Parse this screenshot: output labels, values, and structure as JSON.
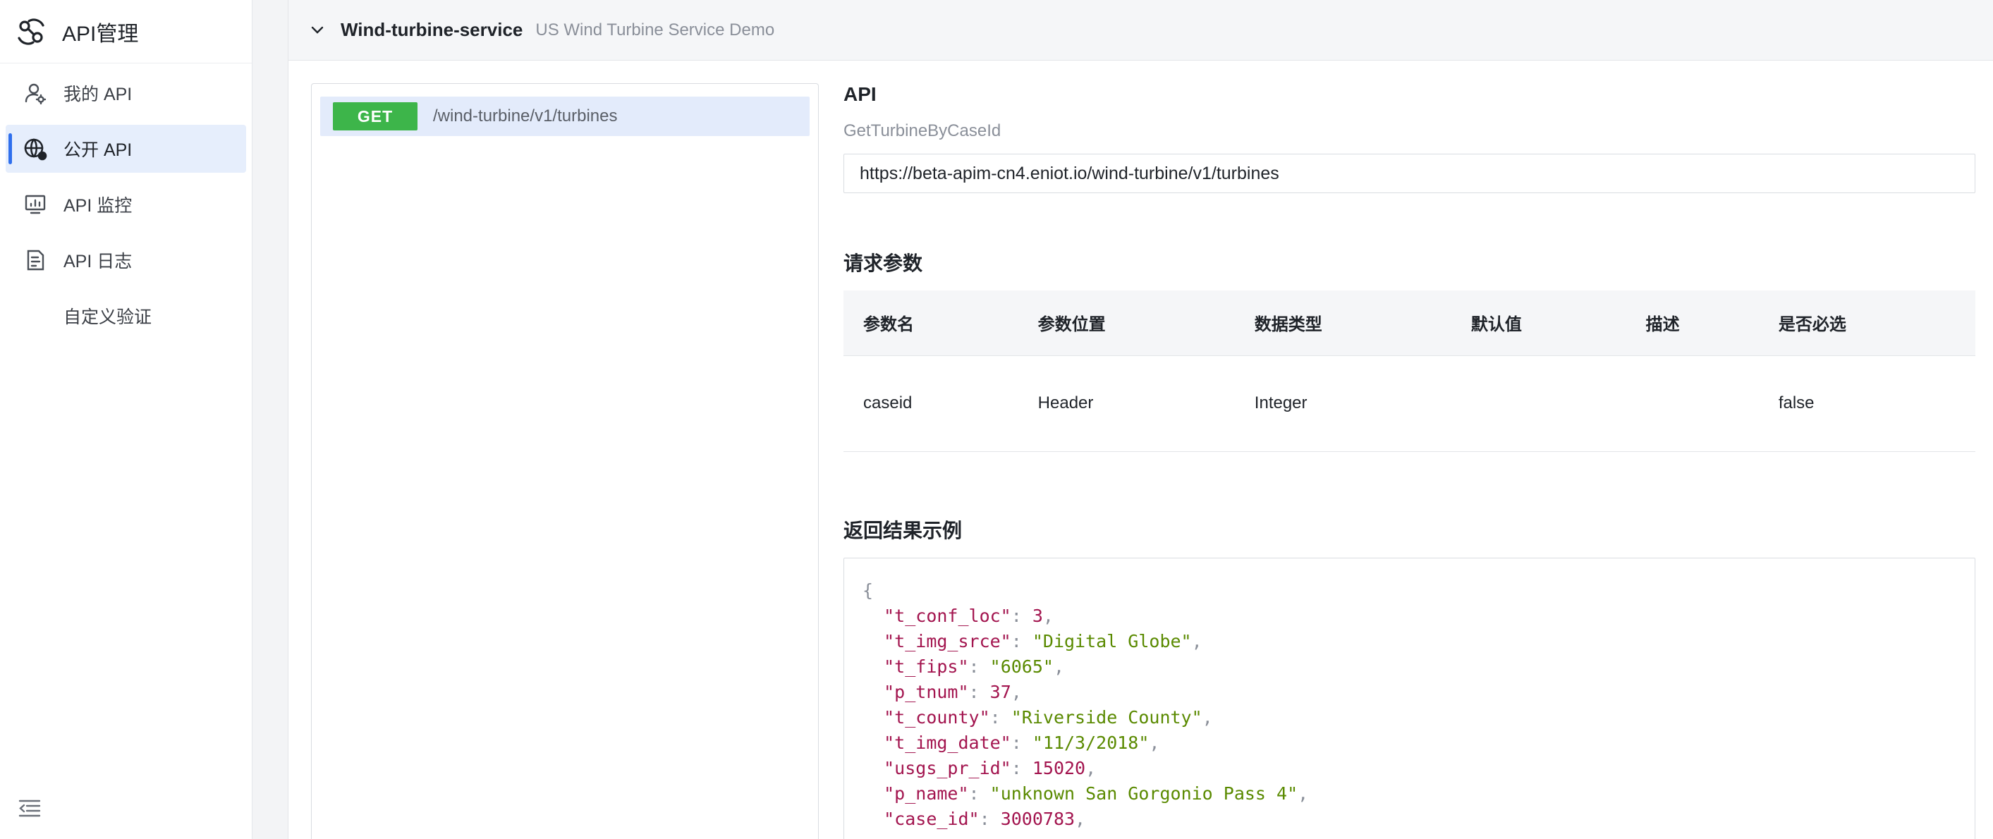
{
  "app": {
    "title": "API管理"
  },
  "sidebar": {
    "items": [
      {
        "label": "我的 API",
        "icon": "user-settings-icon"
      },
      {
        "label": "公开 API",
        "icon": "globe-icon",
        "active": true
      },
      {
        "label": "API 监控",
        "icon": "monitor-chart-icon"
      },
      {
        "label": "API 日志",
        "icon": "document-log-icon"
      },
      {
        "label": "自定义验证"
      }
    ]
  },
  "service": {
    "name": "Wind-turbine-service",
    "description": "US Wind Turbine Service Demo"
  },
  "api_list": [
    {
      "method": "GET",
      "path": "/wind-turbine/v1/turbines"
    }
  ],
  "details": {
    "api_heading": "API",
    "api_name": "GetTurbineByCaseId",
    "url": "https://beta-apim-cn4.eniot.io/wind-turbine/v1/turbines",
    "request_heading": "请求参数",
    "columns": [
      "参数名",
      "参数位置",
      "数据类型",
      "默认值",
      "描述",
      "是否必选"
    ],
    "rows": [
      [
        "caseid",
        "Header",
        "Integer",
        "",
        "",
        "false"
      ]
    ],
    "response_heading": "返回结果示例",
    "response_lines": [
      {
        "key": "t_conf_loc",
        "value": "3",
        "type": "num"
      },
      {
        "key": "t_img_srce",
        "value": "\"Digital Globe\"",
        "type": "str"
      },
      {
        "key": "t_fips",
        "value": "\"6065\"",
        "type": "str"
      },
      {
        "key": "p_tnum",
        "value": "37",
        "type": "num"
      },
      {
        "key": "t_county",
        "value": "\"Riverside County\"",
        "type": "str"
      },
      {
        "key": "t_img_date",
        "value": "\"11/3/2018\"",
        "type": "str"
      },
      {
        "key": "usgs_pr_id",
        "value": "15020",
        "type": "num"
      },
      {
        "key": "p_name",
        "value": "\"unknown San Gorgonio Pass 4\"",
        "type": "str"
      },
      {
        "key": "case_id",
        "value": "3000783",
        "type": "num"
      }
    ]
  },
  "colors": {
    "accent": "#2f6fed",
    "get_badge": "#3db54a",
    "active_bg": "#e6eefc"
  }
}
